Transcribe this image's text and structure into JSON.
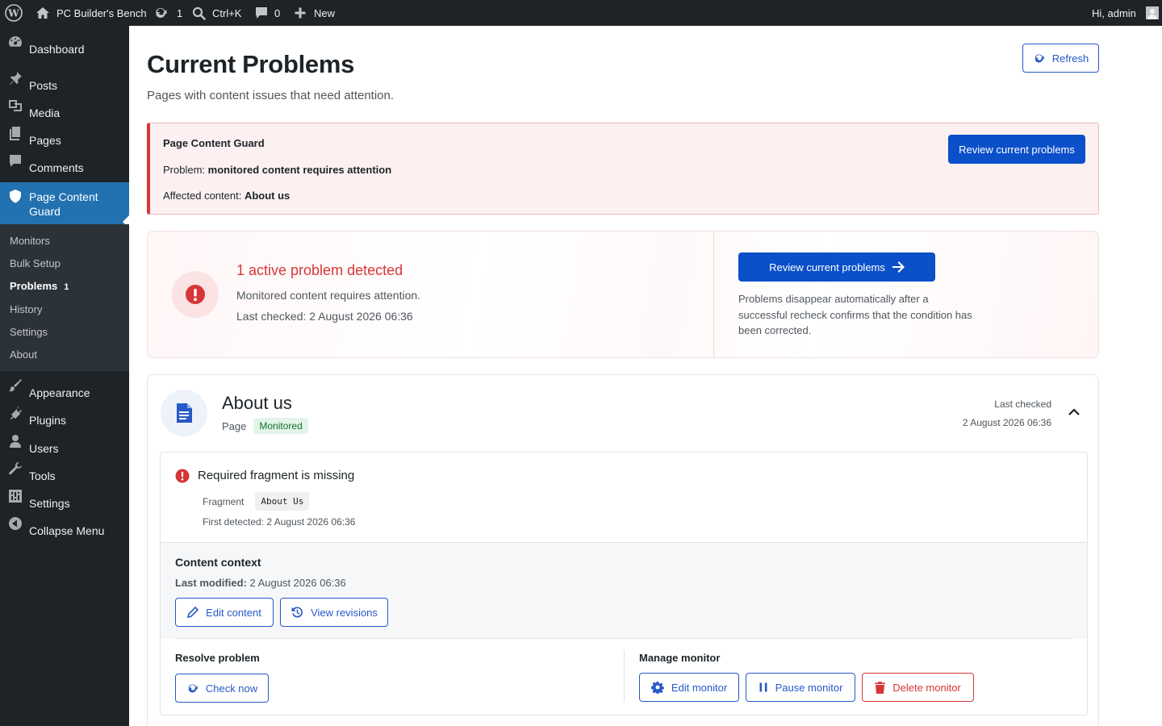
{
  "admin_bar": {
    "site_name": "PC Builder's Bench",
    "updates_count": "1",
    "search_shortcut": "Ctrl+K",
    "comments_count": "0",
    "new_label": "New",
    "greeting": "Hi, admin"
  },
  "sidebar": {
    "items": [
      {
        "label": "Dashboard",
        "icon": "dashboard-icon"
      },
      {
        "label": "Posts",
        "icon": "pin-icon"
      },
      {
        "label": "Media",
        "icon": "media-icon"
      },
      {
        "label": "Pages",
        "icon": "pages-icon"
      },
      {
        "label": "Comments",
        "icon": "comment-icon"
      },
      {
        "label": "Page Content Guard",
        "icon": "shield-icon",
        "active": true
      },
      {
        "label": "Appearance",
        "icon": "brush-icon"
      },
      {
        "label": "Plugins",
        "icon": "plugin-icon"
      },
      {
        "label": "Users",
        "icon": "user-icon"
      },
      {
        "label": "Tools",
        "icon": "wrench-icon"
      },
      {
        "label": "Settings",
        "icon": "sliders-icon"
      },
      {
        "label": "Collapse Menu",
        "icon": "collapse-icon"
      }
    ],
    "submenu": [
      {
        "label": "Monitors"
      },
      {
        "label": "Bulk Setup"
      },
      {
        "label": "Problems",
        "count": "1",
        "current": true
      },
      {
        "label": "History"
      },
      {
        "label": "Settings"
      },
      {
        "label": "About"
      }
    ]
  },
  "header": {
    "title": "Current Problems",
    "subtitle": "Pages with content issues that need attention.",
    "refresh_label": "Refresh"
  },
  "notice": {
    "plugin": "Page Content Guard",
    "problem_prefix": "Problem: ",
    "problem_text": "monitored content requires attention",
    "affected_prefix": "Affected content: ",
    "affected_text": "About us",
    "button_label": "Review current problems"
  },
  "summary": {
    "headline": "1 active problem detected",
    "message": "Monitored content requires attention.",
    "last_checked": "Last checked: 2 August 2026 06:36",
    "button_label": "Review current problems",
    "help_line1": "Problems disappear automatically after a",
    "help_line2": "successful recheck confirms that the condition has",
    "help_line3": "been corrected."
  },
  "item": {
    "title": "About us",
    "type": "Page",
    "status": "Monitored",
    "last_checked_label": "Last checked",
    "last_checked_value": "2 August 2026 06:36",
    "problem": {
      "title": "Required fragment is missing",
      "fragment_label": "Fragment",
      "fragment_value": "About Us",
      "first_detected": "First detected: 2 August 2026 06:36"
    },
    "context": {
      "heading": "Content context",
      "modified_label": "Last modified:",
      "modified_value": "2 August 2026 06:36",
      "edit_label": "Edit content",
      "revisions_label": "View revisions"
    },
    "resolve": {
      "heading": "Resolve problem",
      "check_label": "Check now"
    },
    "manage": {
      "heading": "Manage monitor",
      "edit_label": "Edit monitor",
      "pause_label": "Pause monitor",
      "delete_label": "Delete monitor"
    }
  },
  "colors": {
    "accent": "#0b4fc9",
    "danger": "#d63638",
    "sidebar": "#1d2327",
    "active_menu": "#2271b1"
  }
}
